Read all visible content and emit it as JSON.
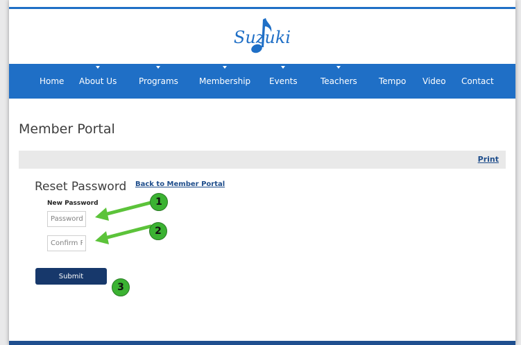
{
  "logo": {
    "text": "Suzuki"
  },
  "nav": {
    "items": [
      {
        "label": "Home",
        "caret": false
      },
      {
        "label": "About Us",
        "caret": true
      },
      {
        "label": "Programs",
        "caret": true
      },
      {
        "label": "Membership",
        "caret": true
      },
      {
        "label": "Events",
        "caret": true
      },
      {
        "label": "Teachers",
        "caret": true
      },
      {
        "label": "Tempo",
        "caret": false
      },
      {
        "label": "Video",
        "caret": false
      },
      {
        "label": "Contact",
        "caret": false
      }
    ]
  },
  "page": {
    "title": "Member Portal",
    "print_label": "Print"
  },
  "form": {
    "heading": "Reset Password",
    "back_link": "Back to Member Portal",
    "new_password_label": "New Password",
    "password_placeholder": "Password",
    "confirm_placeholder": "Confirm Password",
    "submit_label": "Submit"
  },
  "annotations": {
    "step1": "1",
    "step2": "2",
    "step3": "3",
    "badge_color": "#3bb232",
    "arrow_color": "#5cc33a"
  },
  "colors": {
    "nav_bg": "#1f6fc6",
    "button_bg": "#17386b",
    "link": "#1e4d8b"
  }
}
